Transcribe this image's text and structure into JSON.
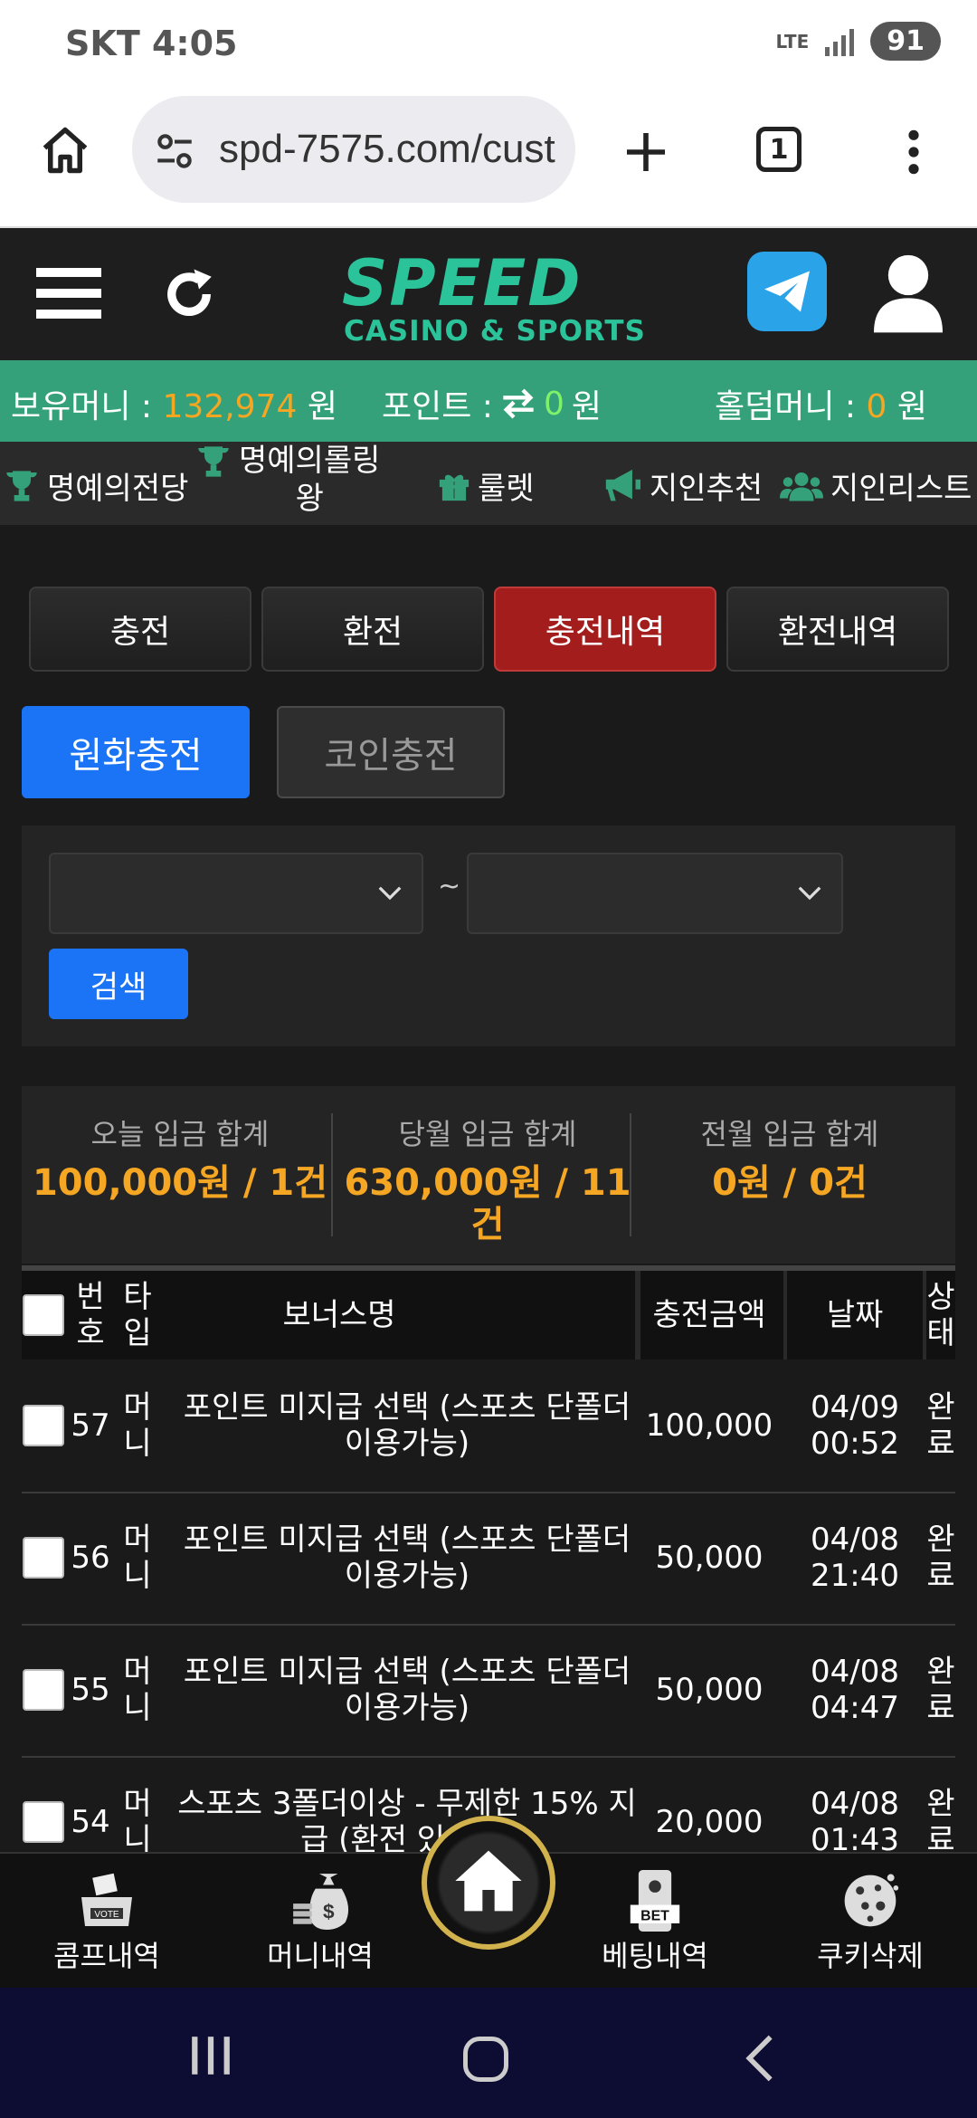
{
  "status_bar": {
    "carrier_time": "SKT 4:05",
    "network": "LTE",
    "battery": "91"
  },
  "browser": {
    "url": "spd-7575.com/cust",
    "tab_count": "1"
  },
  "header": {
    "logo_main": "SPEED",
    "logo_sub": "CASINO & SPORTS",
    "accent_color": "#2bc49a"
  },
  "balance": {
    "money_label": "보유머니 :",
    "money_value": "132,974",
    "money_unit": "원",
    "point_label": "포인트 :",
    "point_value": "0",
    "point_unit": "원",
    "holdem_label": "홀덤머니 :",
    "holdem_value": "0",
    "holdem_unit": "원"
  },
  "menu": {
    "items": [
      {
        "label": "명예의전당",
        "icon": "trophy-icon"
      },
      {
        "label": "명예의롤링",
        "label2": "왕",
        "icon": "trophy-icon"
      },
      {
        "label": "룰렛",
        "icon": "gift-icon"
      },
      {
        "label": "지인추천",
        "icon": "megaphone-icon"
      },
      {
        "label": "지인리스트",
        "icon": "users-icon"
      }
    ]
  },
  "tabs": [
    "충전",
    "환전",
    "충전내역",
    "환전내역"
  ],
  "active_tab": "충전내역",
  "subtabs": [
    "원화충전",
    "코인충전"
  ],
  "filter": {
    "separator": "~",
    "search_label": "검색"
  },
  "summary": [
    {
      "label": "오늘 입금 합계",
      "value": "100,000원 / 1건"
    },
    {
      "label": "당월 입금 합계",
      "value": "630,000원 / 11",
      "value2": "건"
    },
    {
      "label": "전월 입금 합계",
      "value": "0원 / 0건"
    }
  ],
  "table": {
    "headers": {
      "num": [
        "번",
        "호"
      ],
      "type": [
        "타",
        "입"
      ],
      "bonus": "보너스명",
      "amount": "충전금액",
      "date": "날짜",
      "status": [
        "상",
        "태"
      ]
    },
    "rows": [
      {
        "num": "57",
        "type": [
          "머",
          "니"
        ],
        "bonus": [
          "포인트 미지급 선택 (스포츠 단폴더",
          "이용가능)"
        ],
        "amount": "100,000",
        "date": [
          "04/09",
          "00:52"
        ],
        "status": [
          "완",
          "료"
        ]
      },
      {
        "num": "56",
        "type": [
          "머",
          "니"
        ],
        "bonus": [
          "포인트 미지급 선택 (스포츠 단폴더",
          "이용가능)"
        ],
        "amount": "50,000",
        "date": [
          "04/08",
          "21:40"
        ],
        "status": [
          "완",
          "료"
        ]
      },
      {
        "num": "55",
        "type": [
          "머",
          "니"
        ],
        "bonus": [
          "포인트 미지급 선택 (스포츠 단폴더",
          "이용가능)"
        ],
        "amount": "50,000",
        "date": [
          "04/08",
          "04:47"
        ],
        "status": [
          "완",
          "료"
        ]
      },
      {
        "num": "54",
        "type": [
          "머",
          "니"
        ],
        "bonus": [
          "스포츠 3폴더이상 - 무제한 15% 지",
          "급 (환전 있어도)"
        ],
        "amount": "20,000",
        "date": [
          "04/08",
          "01:43"
        ],
        "status": [
          "완",
          "료"
        ]
      }
    ]
  },
  "bottom_nav": [
    "콤프내역",
    "머니내역",
    "베팅내역",
    "쿠키삭제"
  ]
}
